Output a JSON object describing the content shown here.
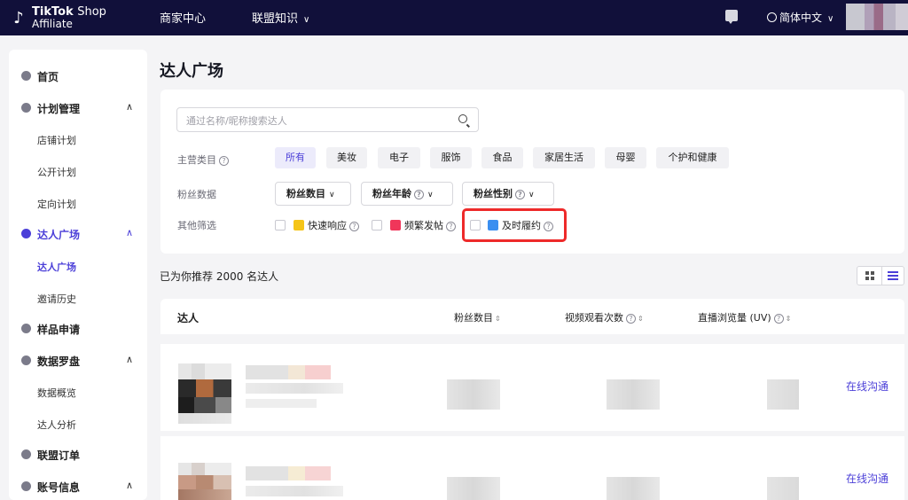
{
  "header": {
    "logo_line1_brand": "TikTok",
    "logo_line1_suffix": "Shop",
    "logo_line2": "Affiliate",
    "nav": [
      "商家中心",
      "联盟知识"
    ],
    "language": "简体中文"
  },
  "sidebar": {
    "items": [
      {
        "label": "首页",
        "icon": "home-icon"
      },
      {
        "label": "计划管理",
        "icon": "plan-icon",
        "subitems": [
          "店铺计划",
          "公开计划",
          "定向计划"
        ]
      },
      {
        "label": "达人广场",
        "icon": "creator-icon",
        "subitems": [
          "达人广场",
          "邀请历史"
        ]
      },
      {
        "label": "样品申请",
        "icon": "sample-icon"
      },
      {
        "label": "数据罗盘",
        "icon": "compass-icon",
        "subitems": [
          "数据概览",
          "达人分析"
        ]
      },
      {
        "label": "联盟订单",
        "icon": "order-icon"
      },
      {
        "label": "账号信息",
        "icon": "account-icon"
      }
    ]
  },
  "main": {
    "title": "达人广场",
    "search": {
      "placeholder": "通过名称/昵称搜索达人"
    },
    "filters": {
      "category_label": "主营类目",
      "categories": [
        "所有",
        "美妆",
        "电子",
        "服饰",
        "食品",
        "家居生活",
        "母婴",
        "个护和健康"
      ],
      "selected_category": "所有",
      "fans_label": "粉丝数据",
      "fans_dropdowns": [
        "粉丝数目",
        "粉丝年龄",
        "粉丝性别"
      ],
      "other_label": "其他筛选",
      "other_options": [
        "快速响应",
        "频繁发帖",
        "及时履约"
      ]
    },
    "result_text": "已为你推荐 2000 名达人",
    "table": {
      "columns": [
        "达人",
        "粉丝数目",
        "视频观看次数",
        "直播浏览量 (UV)"
      ],
      "row_action": "在线沟通"
    }
  },
  "colors": {
    "topbar": "#11103a",
    "accent": "#4b3fd8",
    "highlight": "#ee2a2a"
  }
}
